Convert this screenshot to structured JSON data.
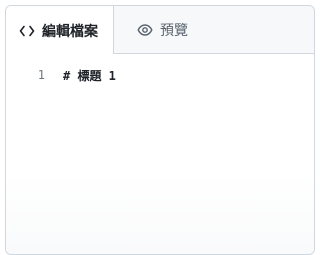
{
  "tabs": {
    "edit": {
      "label": "編輯檔案",
      "icon": "code-icon"
    },
    "preview": {
      "label": "預覽",
      "icon": "eye-icon"
    }
  },
  "editor": {
    "lines": [
      {
        "number": "1",
        "content": "# 標題 1"
      }
    ]
  }
}
